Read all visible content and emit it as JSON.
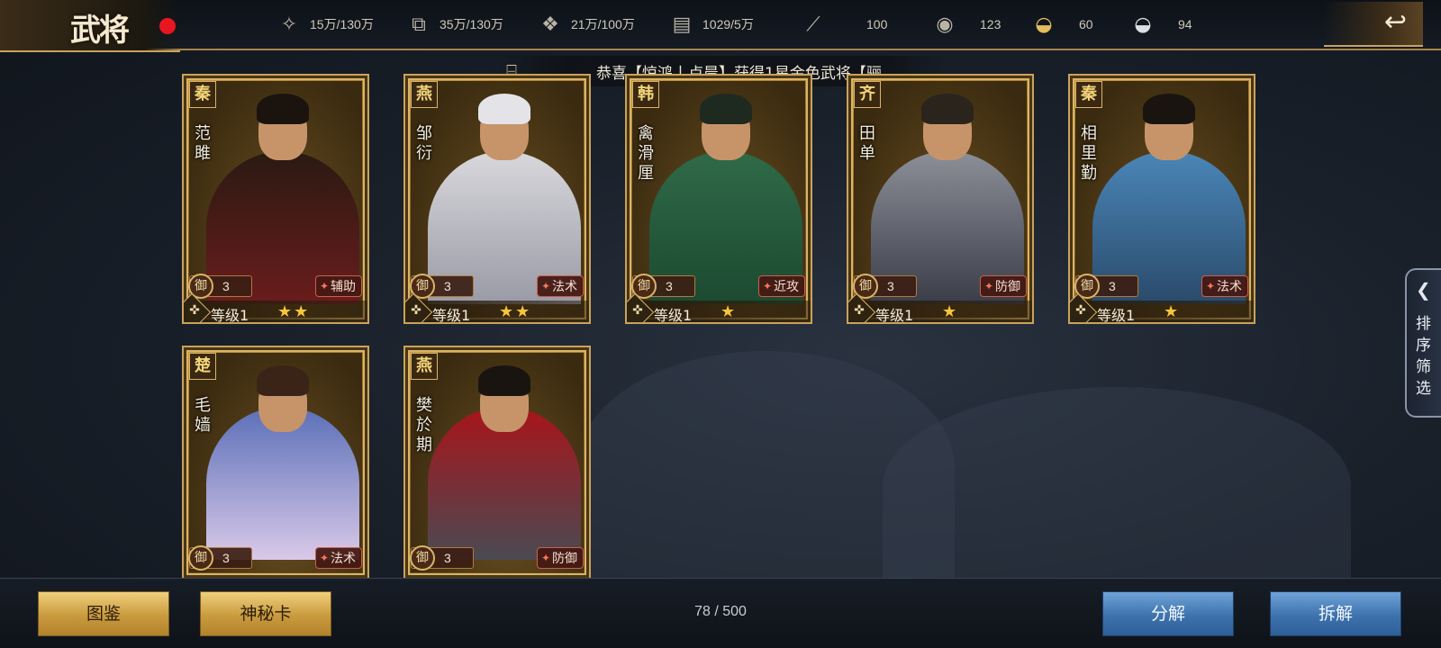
{
  "title": "武将",
  "colors": {
    "gold": "#c9a35c",
    "blue_button": "#3d72ad",
    "red_dot": "#e8161f",
    "star": "#f7c53a"
  },
  "resources": [
    {
      "icon": "wheat-icon",
      "value": "15万/130万"
    },
    {
      "icon": "wood-icon",
      "value": "35万/130万"
    },
    {
      "icon": "stone-icon",
      "value": "21万/100万"
    },
    {
      "icon": "iron-icon",
      "value": "1029/5万"
    },
    {
      "icon": "token-icon",
      "value": "100"
    },
    {
      "icon": "coin-icon",
      "value": "123"
    },
    {
      "icon": "gold-ingot-icon",
      "value": "60"
    },
    {
      "icon": "silver-ingot-icon",
      "value": "94"
    }
  ],
  "marquee": "恭喜【惊鸿丨卢晨】获得1星金色武将【骊",
  "cards": [
    {
      "faction": "秦",
      "name": "范雎",
      "def_label": "御",
      "def": "3",
      "role": "辅助",
      "level": "等级1",
      "stars": 2,
      "palette": "dark"
    },
    {
      "faction": "燕",
      "name": "邹衍",
      "def_label": "御",
      "def": "3",
      "role": "法术",
      "level": "等级1",
      "stars": 2,
      "palette": "grey"
    },
    {
      "faction": "韩",
      "name": "禽滑厘",
      "def_label": "御",
      "def": "3",
      "role": "近攻",
      "level": "等级1",
      "stars": 1,
      "palette": "green"
    },
    {
      "faction": "齐",
      "name": "田单",
      "def_label": "御",
      "def": "3",
      "role": "防御",
      "level": "等级1",
      "stars": 1,
      "palette": "armor"
    },
    {
      "faction": "秦",
      "name": "相里勤",
      "def_label": "御",
      "def": "3",
      "role": "法术",
      "level": "等级1",
      "stars": 1,
      "palette": "blue"
    },
    {
      "faction": "楚",
      "name": "毛嫱",
      "def_label": "御",
      "def": "3",
      "role": "法术",
      "level": "",
      "stars": 0,
      "palette": "lady"
    },
    {
      "faction": "燕",
      "name": "樊於期",
      "def_label": "御",
      "def": "3",
      "role": "防御",
      "level": "",
      "stars": 0,
      "palette": "red"
    }
  ],
  "side_tab": {
    "label": "排序筛选"
  },
  "bottom": {
    "atlas_label": "图鉴",
    "mystery_label": "神秘卡",
    "count": "78 / 500",
    "decompose_label": "分解",
    "dismantle_label": "拆解"
  }
}
